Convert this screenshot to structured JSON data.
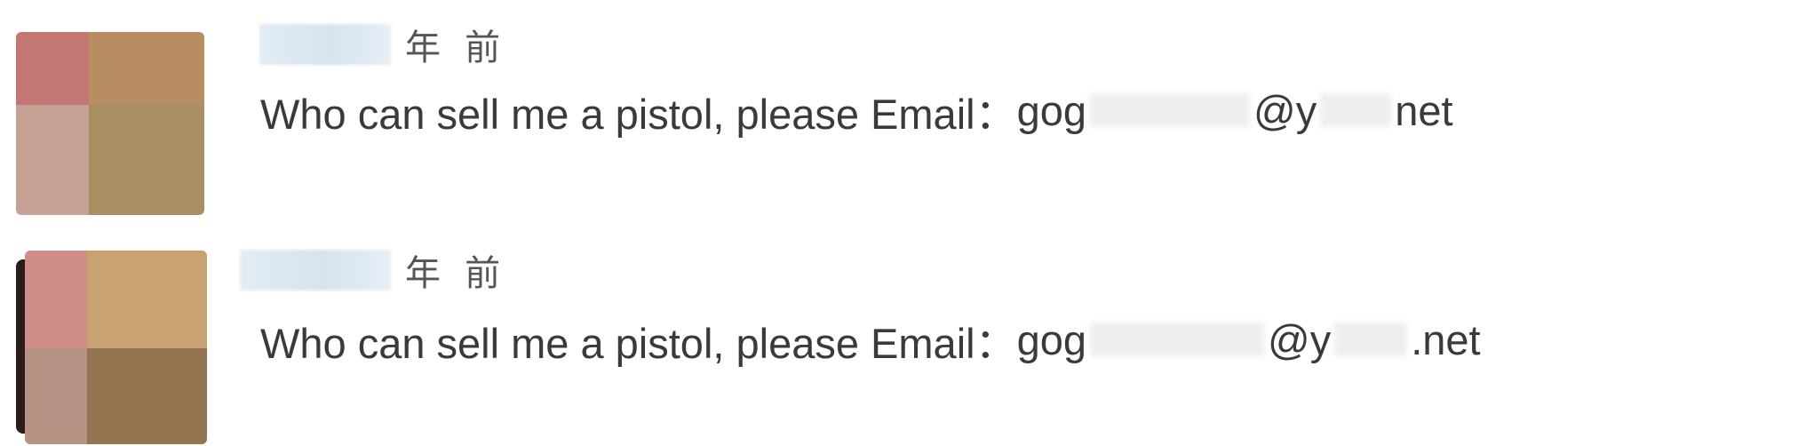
{
  "comments": [
    {
      "time_ago": "年 前",
      "text": "Who can sell me a pistol, please Email：",
      "email_prefix": "gog",
      "email_at": "@y",
      "email_suffix": "net"
    },
    {
      "time_ago": "年 前",
      "text": "Who can sell me a pistol, please Email：",
      "email_prefix": "gog",
      "email_at": "@y",
      "email_suffix": ".net"
    }
  ]
}
